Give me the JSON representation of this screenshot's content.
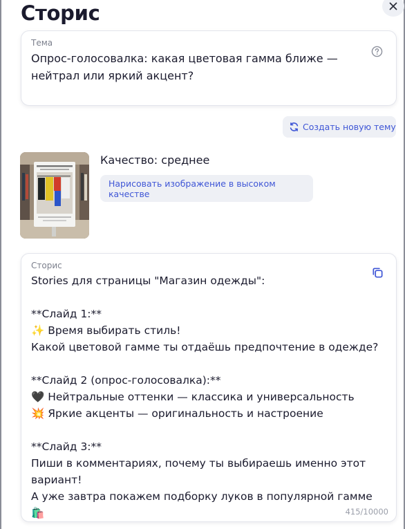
{
  "header": {
    "title": "Сторис",
    "close_icon": "close-icon"
  },
  "topic": {
    "label": "Тема",
    "value": "Опрос-голосовалка: какая цветовая гамма ближе — нейтрал или яркий акцент?",
    "help_icon": "question-circle-icon"
  },
  "actions": {
    "new_topic_label": "Создать новую тему",
    "new_topic_icon": "refresh-icon"
  },
  "image": {
    "quality_text": "Качество: среднее",
    "hq_button_label": "Нарисовать изображение в высоком качестве",
    "thumbnail_icon": "clothing-store-image"
  },
  "story": {
    "label": "Сторис",
    "text": "Stories для страницы \"Магазин одежды\":\n\n**Слайд 1:**\n✨ Время выбирать стиль!\nКакой цветовой гамме ты отдаёшь предпочтение в одежде?\n\n**Слайд 2 (опрос-голосовалка):**\n🖤 Нейтральные оттенки — классика и универсальность\n💥 Яркие акценты — оригинальность и настроение\n\n**Слайд 3:**\nПиши в комментариях, почему ты выбираешь именно этот вариант!\nА уже завтра покажем подборку луков в популярной гамме 🛍️",
    "counter": "415/10000",
    "copy_icon": "copy-icon"
  },
  "colors": {
    "accent": "#3f56d6",
    "button_bg": "#eef0f5",
    "text": "#1b1b2e",
    "muted": "#7b7f8c"
  }
}
